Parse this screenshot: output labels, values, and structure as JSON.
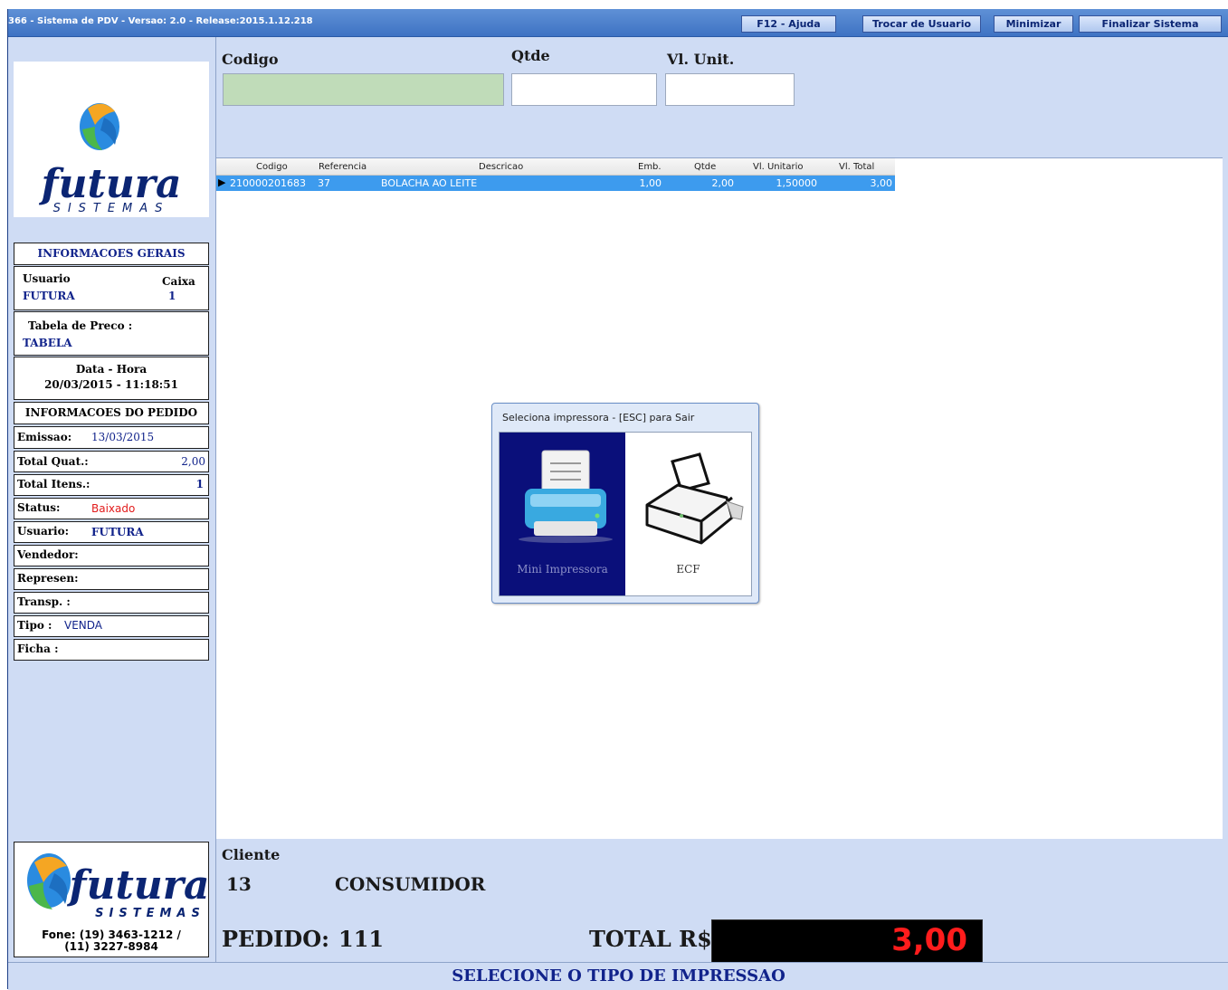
{
  "titlebar": {
    "title": "366 - Sistema de PDV - Versao: 2.0 - Release:2015.1.12.218",
    "buttons": [
      "F12 - Ajuda",
      "Trocar de Usuario",
      "Minimizar",
      "Finalizar Sistema"
    ]
  },
  "logo": {
    "word": "futura",
    "sub": "SISTEMAS"
  },
  "info": {
    "header": "INFORMACOES GERAIS",
    "usuario_label": "Usuario",
    "usuario_value": "FUTURA",
    "caixa_label": "Caixa",
    "caixa_value": "1",
    "tabela_label": "Tabela de Preco :",
    "tabela_value": "TABELA",
    "datahora_label": "Data - Hora",
    "datahora_value": "20/03/2015 - 11:18:51"
  },
  "pedido_info": {
    "header": "INFORMACOES DO PEDIDO",
    "emissao_label": "Emissao:",
    "emissao_value": "13/03/2015",
    "total_quat_label": "Total Quat.:",
    "total_quat_value": "2,00",
    "total_itens_label": "Total Itens.:",
    "total_itens_value": "1",
    "status_label": "Status:",
    "status_value": "Baixado",
    "usuario_label": "Usuario:",
    "usuario_value": "FUTURA",
    "vendedor_label": "Vendedor:",
    "represen_label": "Represen:",
    "transp_label": "Transp. :",
    "tipo_label": "Tipo :",
    "tipo_value": "VENDA",
    "ficha_label": "Ficha :"
  },
  "footer_logo": {
    "fone": "Fone: (19) 3463-1212 /",
    "fone2": "(11) 3227-8984"
  },
  "fields": {
    "codigo_label": "Codigo",
    "qtde_label": "Qtde",
    "vlunit_label": "Vl. Unit."
  },
  "grid": {
    "columns": [
      "Codigo",
      "Referencia",
      "Descricao",
      "Emb.",
      "Qtde",
      "Vl. Unitario",
      "Vl. Total"
    ],
    "rows": [
      {
        "codigo": "210000201683",
        "referencia": "37",
        "descricao": "BOLACHA AO LEITE",
        "emb": "1,00",
        "qtde": "2,00",
        "vl_unitario": "1,50000",
        "vl_total": "3,00"
      }
    ]
  },
  "dialog": {
    "title": "Seleciona impressora - [ESC] para Sair",
    "options": [
      "Mini Impressora",
      "ECF"
    ]
  },
  "cliente": {
    "label": "Cliente",
    "codigo": "13",
    "nome": "CONSUMIDOR"
  },
  "pedido": {
    "label": "PEDIDO:",
    "numero": "111"
  },
  "total": {
    "label": "TOTAL R$",
    "value": "3,00"
  },
  "status_message": "SELECIONE O TIPO DE IMPRESSAO",
  "colors": {
    "accent": "#11238b",
    "row_selected": "#3d9bee",
    "total_bg": "#000000",
    "total_fg": "#ff1c1c"
  }
}
